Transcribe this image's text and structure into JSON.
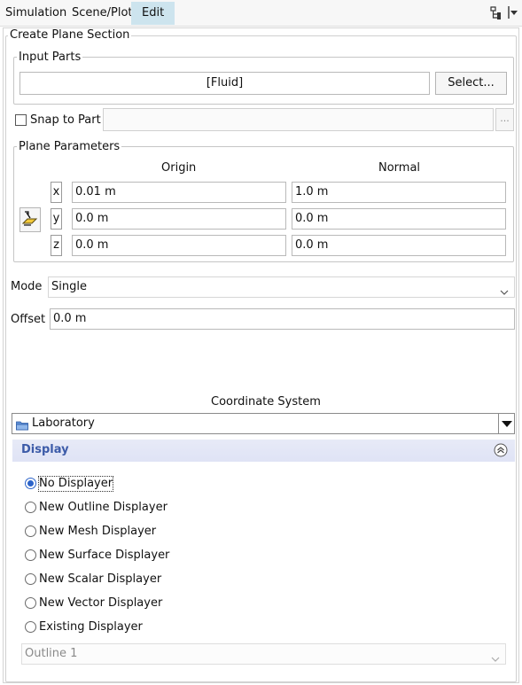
{
  "tabs": [
    {
      "label": "Simulation"
    },
    {
      "label": "Scene/Plot"
    },
    {
      "label": "Edit"
    }
  ],
  "toolbar_icons": [
    "tree-icon",
    "dropdown-arrow-icon"
  ],
  "panel": {
    "title": "Create Plane Section",
    "input_parts": {
      "legend": "Input Parts",
      "value": "[Fluid]",
      "select_button": "Select..."
    },
    "snap_to_part": {
      "label": "Snap to Part",
      "checked": false,
      "value": "",
      "browse_button": "..."
    },
    "plane_parameters": {
      "legend": "Plane Parameters",
      "origin_header": "Origin",
      "normal_header": "Normal",
      "rows": [
        {
          "axis": "x",
          "origin": "0.01 m",
          "normal": "1.0 m"
        },
        {
          "axis": "y",
          "origin": "0.0 m",
          "normal": "0.0 m"
        },
        {
          "axis": "z",
          "origin": "0.0 m",
          "normal": "0.0 m"
        }
      ]
    },
    "mode": {
      "label": "Mode",
      "value": "Single"
    },
    "offset": {
      "label": "Offset",
      "value": "0.0 m"
    },
    "coordinate_system": {
      "label": "Coordinate System",
      "value": "Laboratory"
    },
    "display": {
      "title": "Display",
      "options": [
        {
          "label": "No Displayer",
          "checked": true
        },
        {
          "label": "New Outline Displayer",
          "checked": false
        },
        {
          "label": "New Mesh Displayer",
          "checked": false
        },
        {
          "label": "New Surface Displayer",
          "checked": false
        },
        {
          "label": "New Scalar Displayer",
          "checked": false
        },
        {
          "label": "New Vector Displayer",
          "checked": false
        },
        {
          "label": "Existing Displayer",
          "checked": false
        }
      ],
      "existing_select": "Outline 1"
    }
  },
  "colors": {
    "active_tab": "#cde4ee",
    "display_header": "#e2e6f6",
    "display_title": "#3c5ba8",
    "radio_checked": "#2b63c9"
  }
}
